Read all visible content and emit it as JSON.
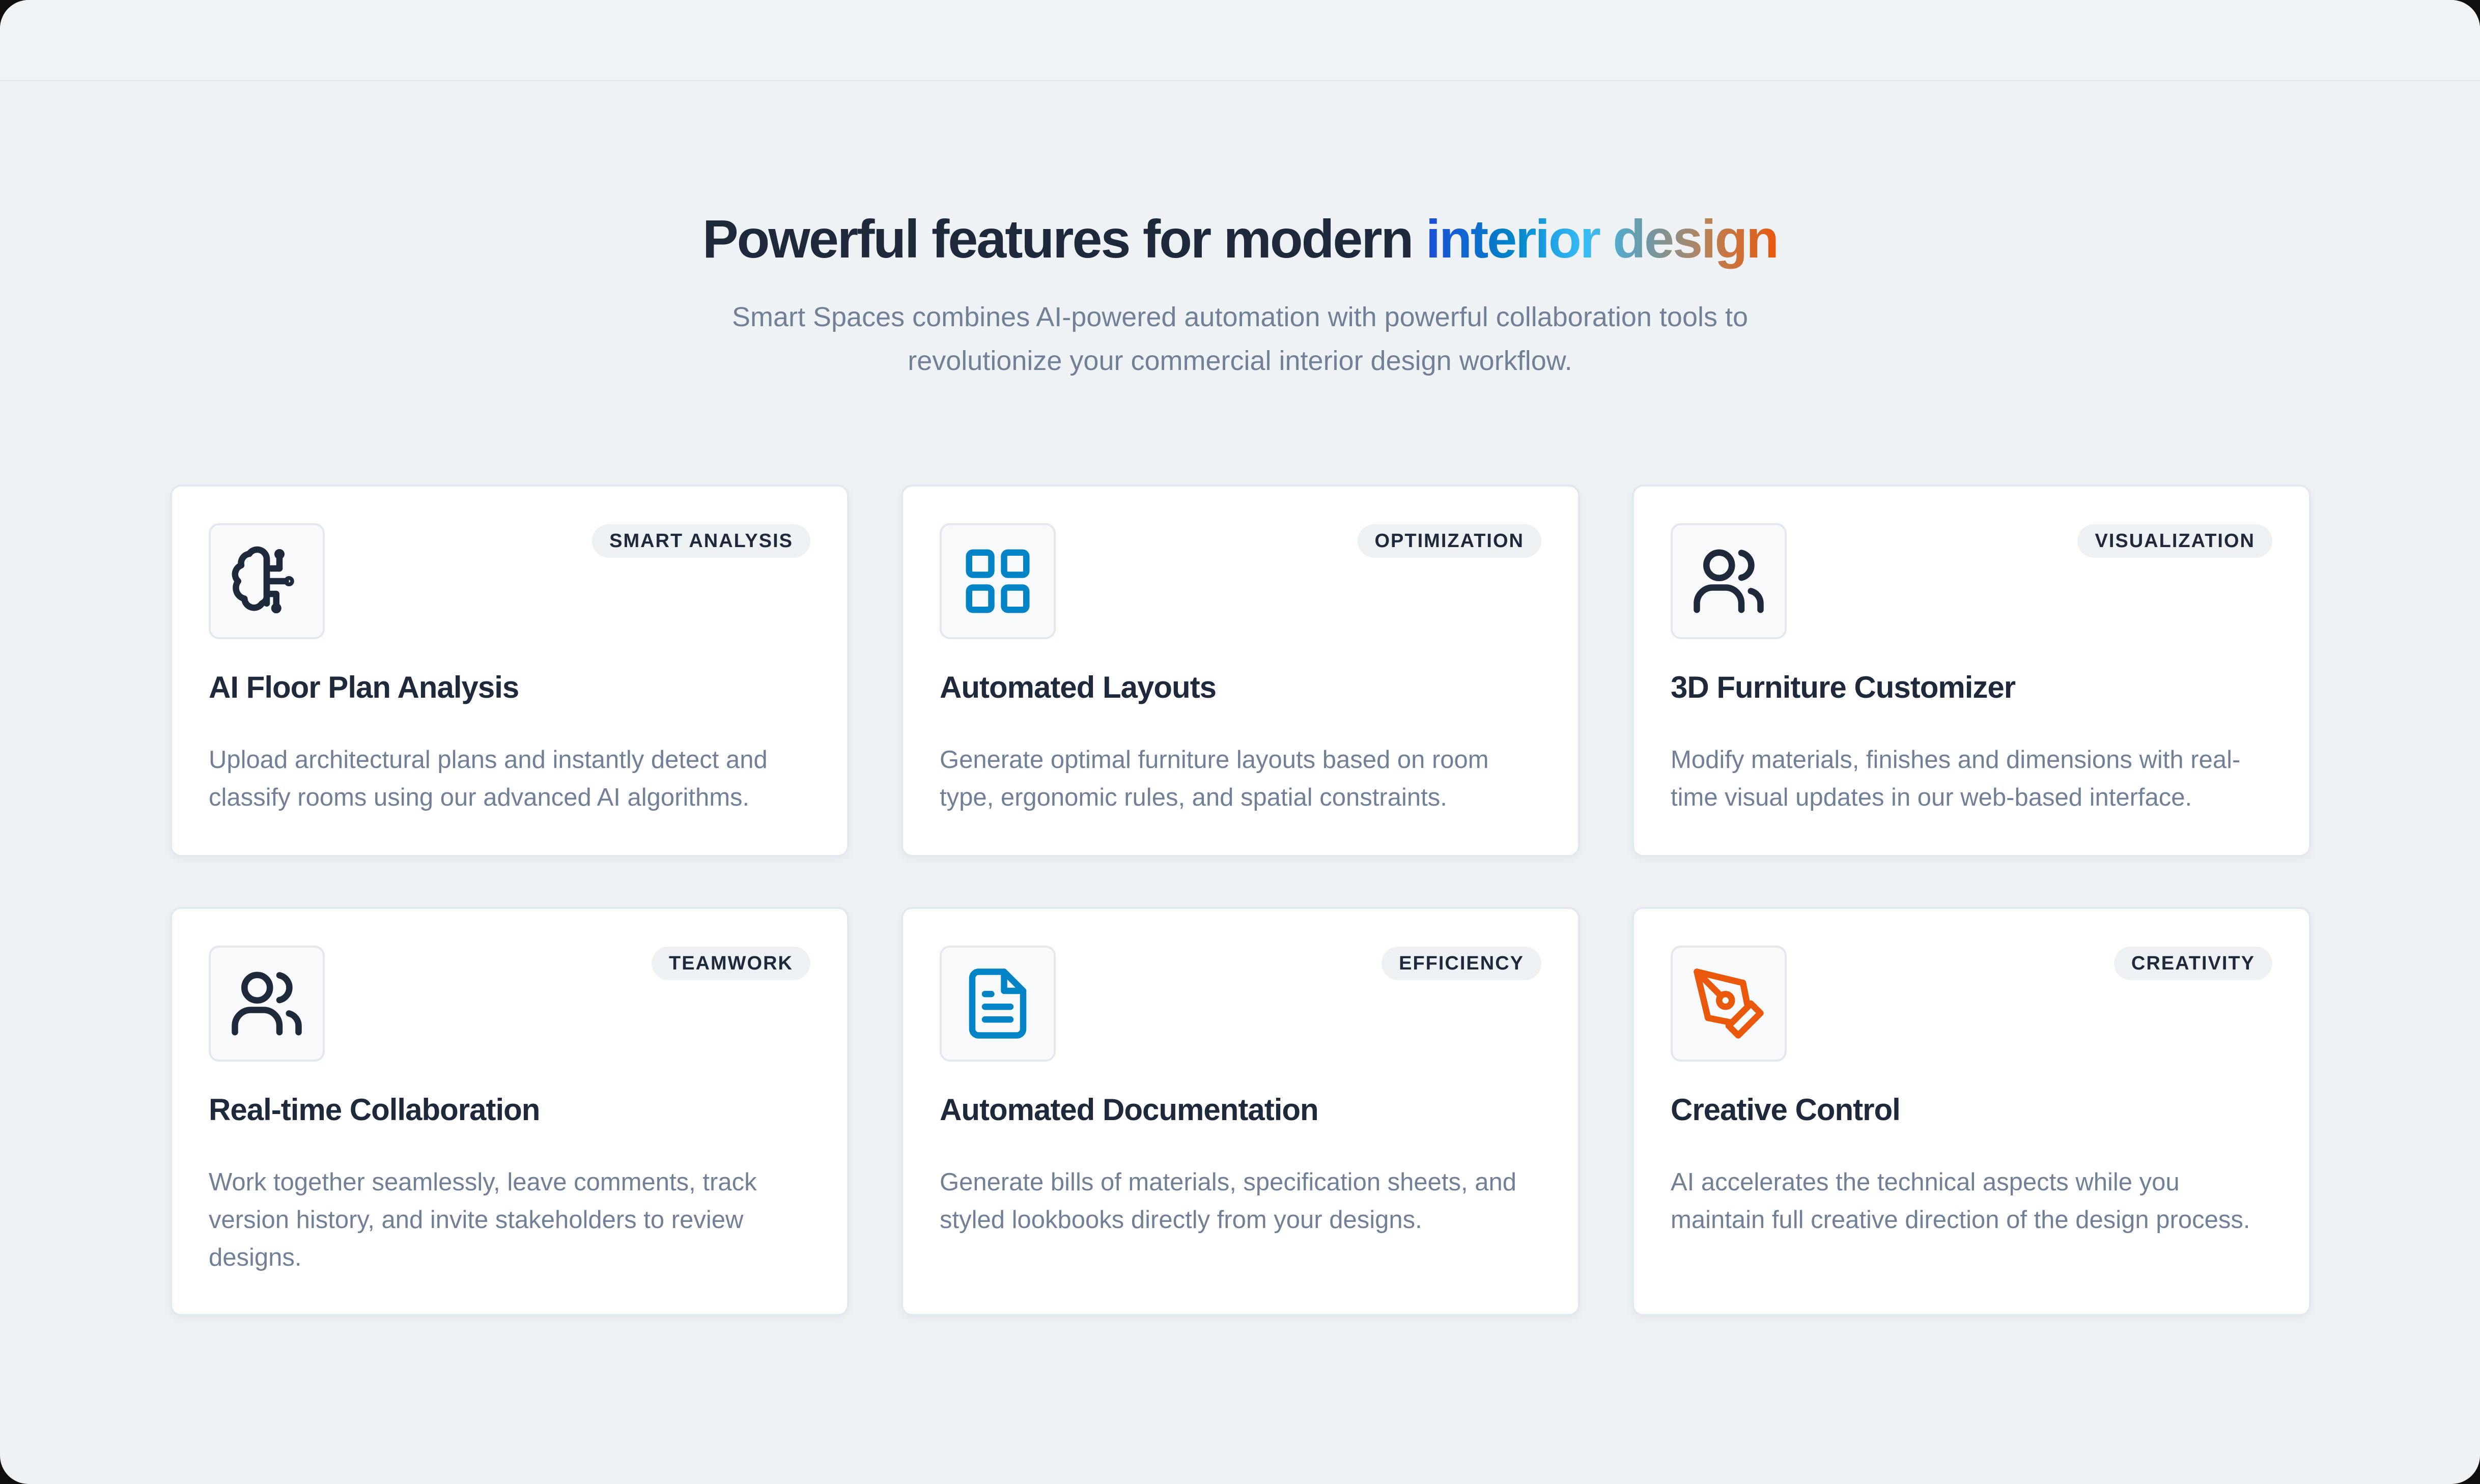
{
  "section": {
    "title_part1": "Powerful features for modern ",
    "title_accent": "interior design",
    "subtitle": "Smart Spaces combines AI-powered automation with powerful collaboration tools to revolutionize your commercial interior design workflow."
  },
  "features": [
    {
      "badge": "SMART ANALYSIS",
      "title": "AI Floor Plan Analysis",
      "description": "Upload architectural plans and instantly detect and classify rooms using our advanced AI algorithms.",
      "icon": "brain-icon",
      "icon_color": "#1e293b"
    },
    {
      "badge": "OPTIMIZATION",
      "title": "Automated Layouts",
      "description": "Generate optimal furniture layouts based on room type, ergonomic rules, and spatial constraints.",
      "icon": "grid-icon",
      "icon_color": "#0284c7"
    },
    {
      "badge": "VISUALIZATION",
      "title": "3D Furniture Customizer",
      "description": "Modify materials, finishes and dimensions with real-time visual updates in our web-based interface.",
      "icon": "users-icon",
      "icon_color": "#1e293b"
    },
    {
      "badge": "TEAMWORK",
      "title": "Real-time Collaboration",
      "description": "Work together seamlessly, leave comments, track version history, and invite stakeholders to review designs.",
      "icon": "users-icon",
      "icon_color": "#1e293b"
    },
    {
      "badge": "EFFICIENCY",
      "title": "Automated Documentation",
      "description": "Generate bills of materials, specification sheets, and styled lookbooks directly from your designs.",
      "icon": "document-icon",
      "icon_color": "#0284c7"
    },
    {
      "badge": "CREATIVITY",
      "title": "Creative Control",
      "description": "AI accelerates the technical aspects while you maintain full creative direction of the design process.",
      "icon": "pen-tool-icon",
      "icon_color": "#ea580c"
    }
  ]
}
